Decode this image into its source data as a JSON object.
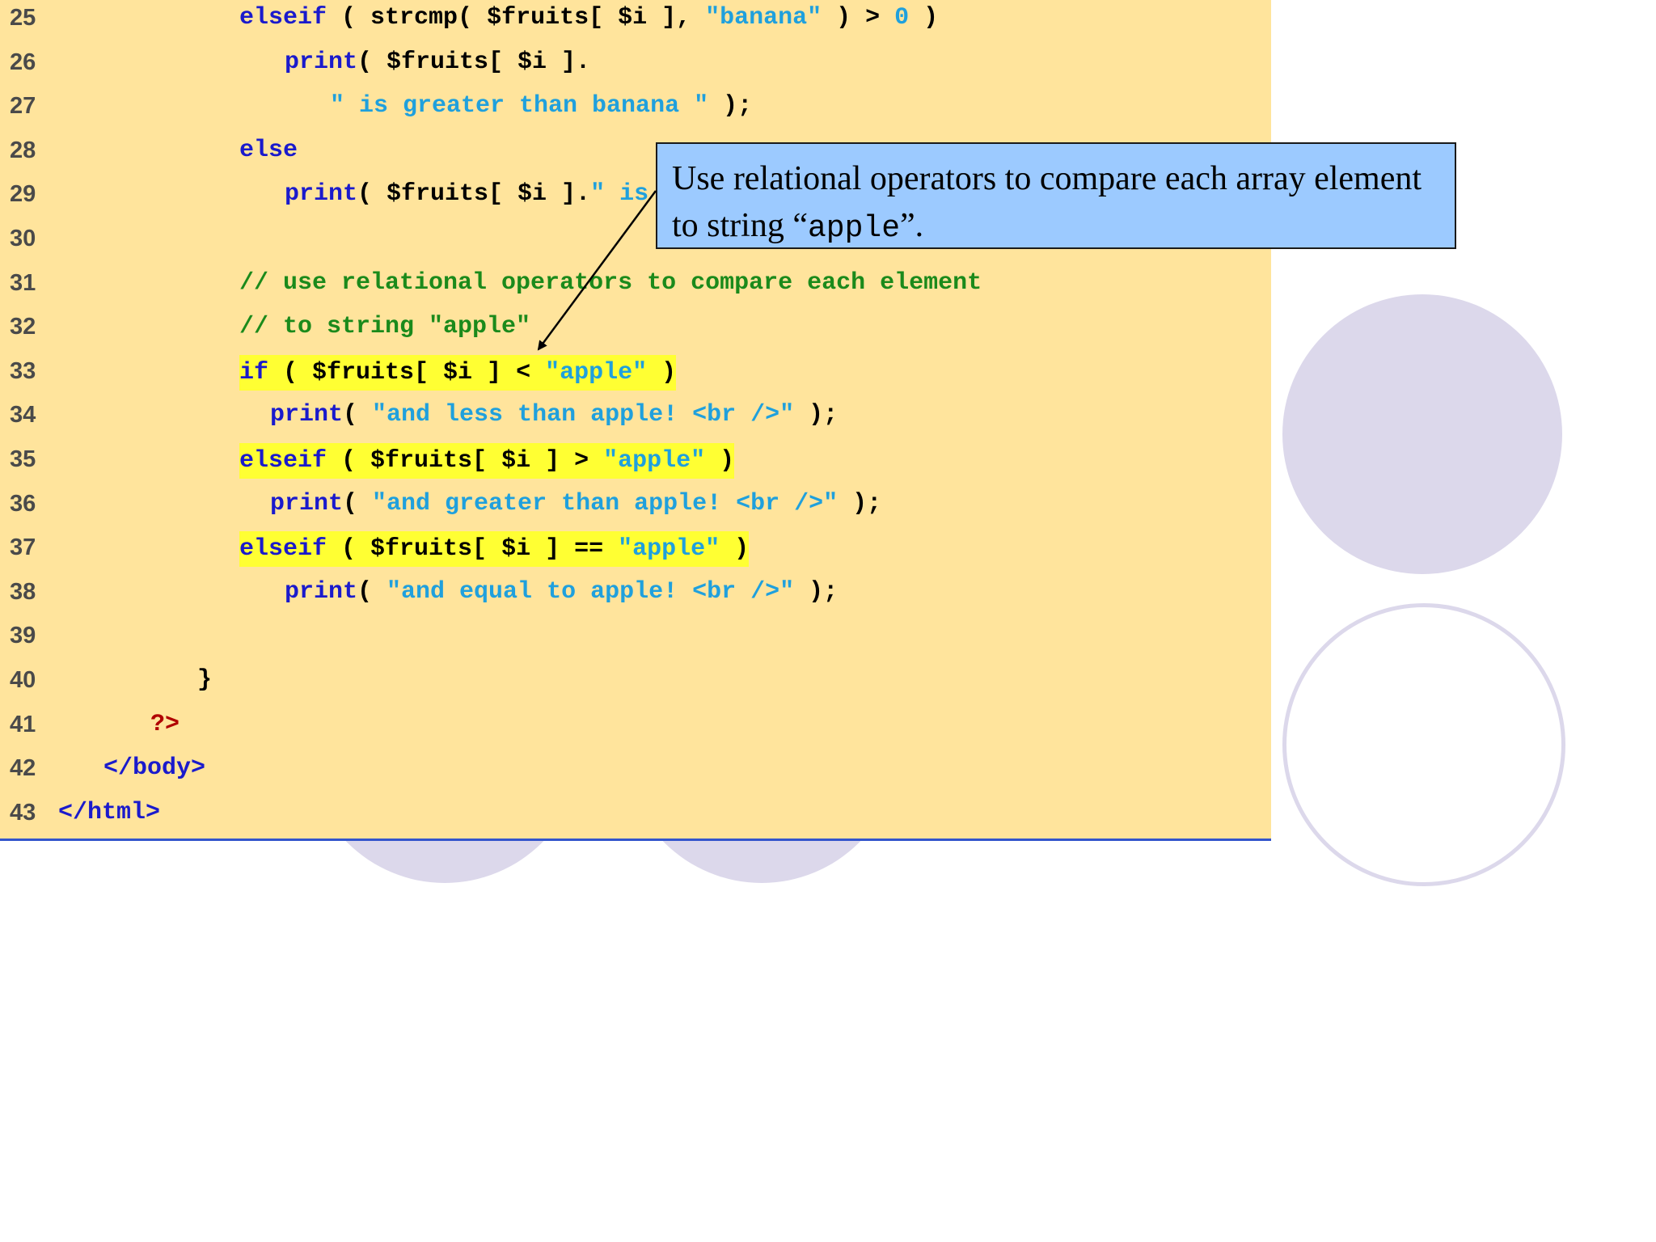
{
  "lines": [
    {
      "num": "25",
      "indent": 296,
      "hl": false,
      "tokens": [
        [
          "kw",
          "elseif"
        ],
        [
          "plain",
          " ( strcmp( $fruits[ $i ], "
        ],
        [
          "str",
          "\"banana\""
        ],
        [
          "plain",
          " ) > "
        ],
        [
          "str",
          "0"
        ],
        [
          "plain",
          " )"
        ]
      ]
    },
    {
      "num": "26",
      "indent": 352,
      "hl": false,
      "tokens": [
        [
          "kw",
          "print"
        ],
        [
          "plain",
          "( $fruits[ $i ]."
        ]
      ]
    },
    {
      "num": "27",
      "indent": 408,
      "hl": false,
      "tokens": [
        [
          "str",
          "\" is greater than banana \""
        ],
        [
          "plain",
          " );"
        ]
      ]
    },
    {
      "num": "28",
      "indent": 296,
      "hl": false,
      "tokens": [
        [
          "kw",
          "else"
        ]
      ]
    },
    {
      "num": "29",
      "indent": 352,
      "hl": false,
      "tokens": [
        [
          "kw",
          "print"
        ],
        [
          "plain",
          "( $fruits[ $i ]."
        ],
        [
          "str",
          "\" is"
        ]
      ]
    },
    {
      "num": "30",
      "indent": 296,
      "hl": false,
      "tokens": []
    },
    {
      "num": "31",
      "indent": 296,
      "hl": false,
      "tokens": [
        [
          "cmt",
          "// use relational operators to compare each element"
        ]
      ]
    },
    {
      "num": "32",
      "indent": 296,
      "hl": false,
      "tokens": [
        [
          "cmt",
          "// to string \"apple\""
        ]
      ]
    },
    {
      "num": "33",
      "indent": 296,
      "hl": true,
      "tokens": [
        [
          "kw",
          "if"
        ],
        [
          "plain",
          " ( $fruits[ $i ] < "
        ],
        [
          "str",
          "\"apple\""
        ],
        [
          "plain",
          " )"
        ]
      ]
    },
    {
      "num": "34",
      "indent": 334,
      "hl": false,
      "tokens": [
        [
          "kw",
          "print"
        ],
        [
          "plain",
          "( "
        ],
        [
          "str",
          "\"and less than apple! <br />\""
        ],
        [
          "plain",
          " );"
        ]
      ]
    },
    {
      "num": "35",
      "indent": 296,
      "hl": true,
      "tokens": [
        [
          "kw",
          "elseif"
        ],
        [
          "plain",
          " ( $fruits[ $i ] > "
        ],
        [
          "str",
          "\"apple\""
        ],
        [
          "plain",
          " )"
        ]
      ]
    },
    {
      "num": "36",
      "indent": 334,
      "hl": false,
      "tokens": [
        [
          "kw",
          "print"
        ],
        [
          "plain",
          "( "
        ],
        [
          "str",
          "\"and greater than apple! <br />\""
        ],
        [
          "plain",
          " );"
        ]
      ]
    },
    {
      "num": "37",
      "indent": 296,
      "hl": true,
      "tokens": [
        [
          "kw",
          "elseif"
        ],
        [
          "plain",
          " ( $fruits[ $i ] == "
        ],
        [
          "str",
          "\"apple\""
        ],
        [
          "plain",
          " )"
        ]
      ]
    },
    {
      "num": "38",
      "indent": 352,
      "hl": false,
      "tokens": [
        [
          "kw",
          "print"
        ],
        [
          "plain",
          "( "
        ],
        [
          "str",
          "\"and equal to apple! <br />\""
        ],
        [
          "plain",
          " );"
        ]
      ]
    },
    {
      "num": "39",
      "indent": 296,
      "hl": false,
      "tokens": []
    },
    {
      "num": "40",
      "indent": 244,
      "hl": false,
      "tokens": [
        [
          "plain",
          "}"
        ]
      ]
    },
    {
      "num": "41",
      "indent": 186,
      "hl": false,
      "tokens": [
        [
          "php",
          "?>"
        ]
      ]
    },
    {
      "num": "42",
      "indent": 128,
      "hl": false,
      "tokens": [
        [
          "kw",
          "</body>"
        ]
      ]
    },
    {
      "num": "43",
      "indent": 72,
      "hl": false,
      "tokens": [
        [
          "kw",
          "</html>"
        ]
      ]
    }
  ],
  "callout": {
    "text_before": "Use relational operators to compare each array element to string “",
    "code": "apple",
    "text_after": "”."
  }
}
